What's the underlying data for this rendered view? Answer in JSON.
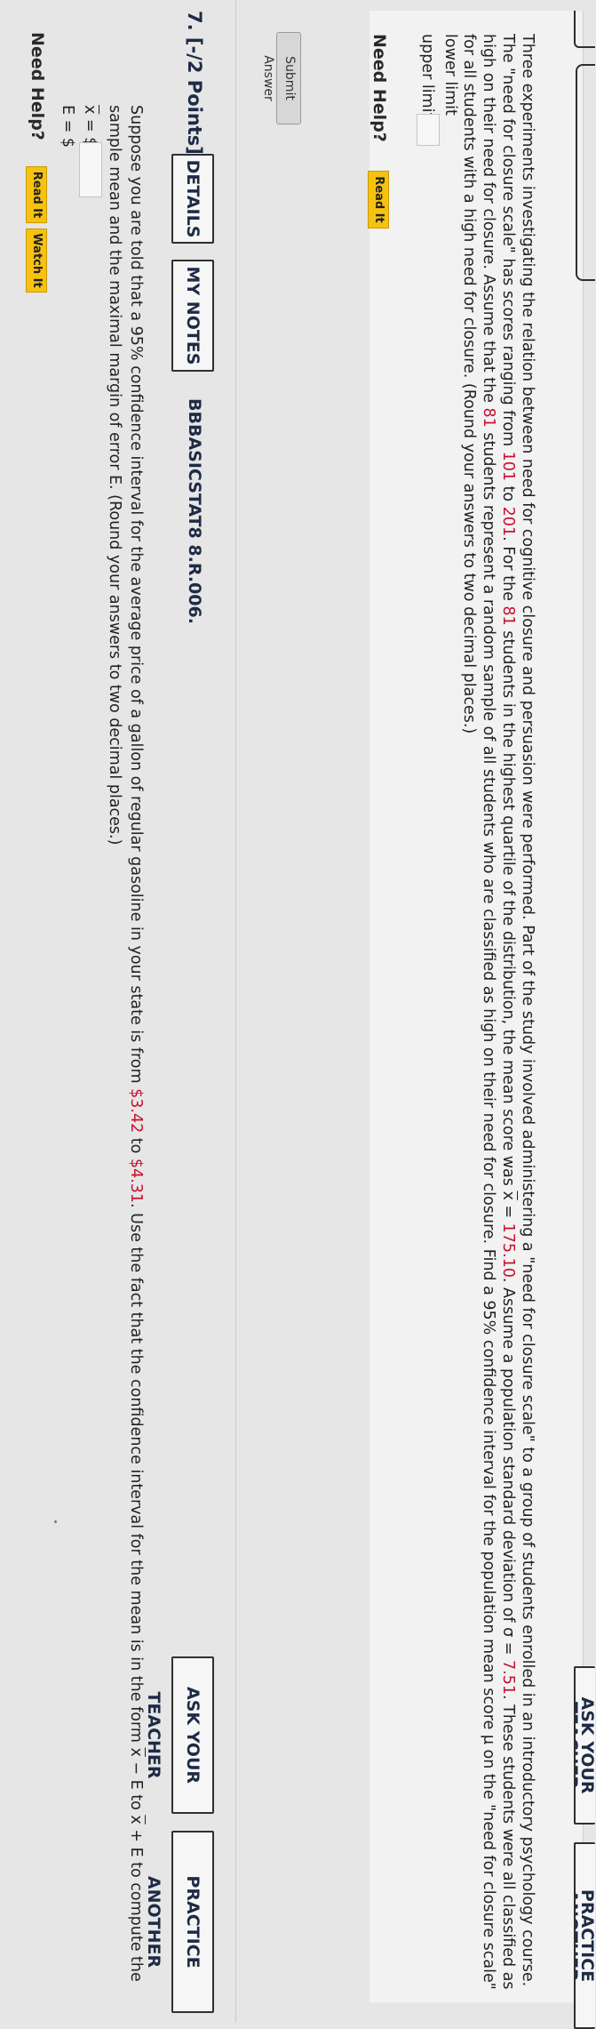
{
  "top": {
    "ask_teacher": "ASK YOUR TEACHER",
    "practice_another": "PRACTICE ANOTHER"
  },
  "q6": {
    "text_1": "Three experiments investigating the relation between need for cognitive closure and persuasion were performed. Part of the study involved administering a \"need for closure scale\" to a group of students enrolled in an introductory psychology course. The \"need for closure scale\" has scores ranging from ",
    "score_min": "101",
    "text_2": " to ",
    "score_max": "201",
    "text_3": ". For the ",
    "n": "81",
    "text_4": " students in the highest quartile of the distribution, the mean score was ",
    "xbar_symbol": "x",
    "text_5": " = ",
    "mean": "175.10",
    "text_6": ". Assume a population standard deviation of σ = ",
    "sigma": "7.51",
    "text_7": ". These students were all classified as high on their need for closure. Assume that the ",
    "n2": "81",
    "text_8": " students represent a random sample of all students who are classified as high on their need for closure. Find a 95% confidence interval for the population mean score μ on the \"need for closure scale\" for all students with a high need for closure. (Round your answers to two decimal places.)",
    "lower_label": "lower limit",
    "upper_label": "upper limit",
    "need_help": "Need Help?",
    "read_it": "Read It",
    "submit": "Submit Answer"
  },
  "q7": {
    "number": "7.  [-/2 Points]",
    "details": "DETAILS",
    "my_notes": "MY NOTES",
    "code": "BBBASICSTAT8 8.R.006.",
    "ask_teacher": "ASK YOUR TEACHER",
    "practice_another": "PRACTICE ANOTHER",
    "text_1": "Suppose you are told that a 95% confidence interval for the average price of a gallon of regular gasoline in your state is from ",
    "price_low": "$3.42",
    "text_2": " to ",
    "price_high": "$4.31",
    "text_3": ". Use the fact that the confidence interval for the mean is in the form ",
    "form_1": "x",
    "form_2": " − E to ",
    "form_3": "x",
    "form_4": " + E to compute the sample mean and the maximal margin of error E. (Round your answers to two decimal places.)",
    "xbar_label_sym": "x",
    "xbar_label_rest": " = $",
    "e_label": "E = $",
    "need_help": "Need Help?",
    "read_it": "Read It",
    "watch_it": "Watch It"
  }
}
